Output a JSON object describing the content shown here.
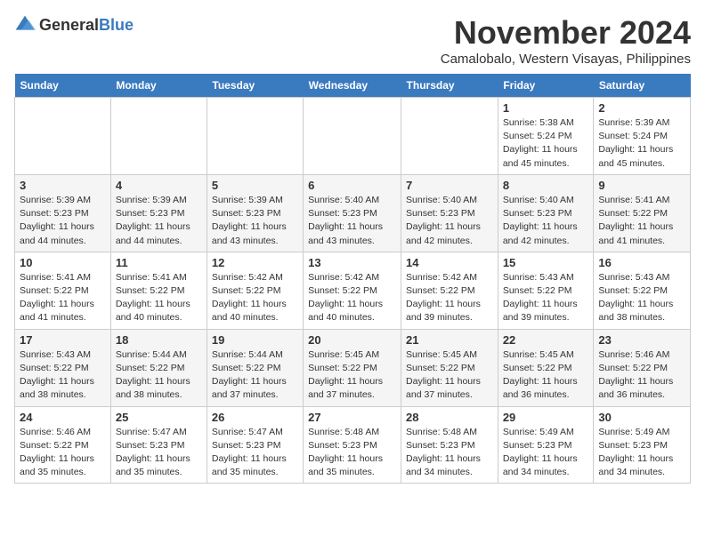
{
  "logo": {
    "general": "General",
    "blue": "Blue"
  },
  "header": {
    "month_year": "November 2024",
    "location": "Camalobalo, Western Visayas, Philippines"
  },
  "days_of_week": [
    "Sunday",
    "Monday",
    "Tuesday",
    "Wednesday",
    "Thursday",
    "Friday",
    "Saturday"
  ],
  "weeks": [
    [
      {
        "day": "",
        "info": ""
      },
      {
        "day": "",
        "info": ""
      },
      {
        "day": "",
        "info": ""
      },
      {
        "day": "",
        "info": ""
      },
      {
        "day": "",
        "info": ""
      },
      {
        "day": "1",
        "info": "Sunrise: 5:38 AM\nSunset: 5:24 PM\nDaylight: 11 hours and 45 minutes."
      },
      {
        "day": "2",
        "info": "Sunrise: 5:39 AM\nSunset: 5:24 PM\nDaylight: 11 hours and 45 minutes."
      }
    ],
    [
      {
        "day": "3",
        "info": "Sunrise: 5:39 AM\nSunset: 5:23 PM\nDaylight: 11 hours and 44 minutes."
      },
      {
        "day": "4",
        "info": "Sunrise: 5:39 AM\nSunset: 5:23 PM\nDaylight: 11 hours and 44 minutes."
      },
      {
        "day": "5",
        "info": "Sunrise: 5:39 AM\nSunset: 5:23 PM\nDaylight: 11 hours and 43 minutes."
      },
      {
        "day": "6",
        "info": "Sunrise: 5:40 AM\nSunset: 5:23 PM\nDaylight: 11 hours and 43 minutes."
      },
      {
        "day": "7",
        "info": "Sunrise: 5:40 AM\nSunset: 5:23 PM\nDaylight: 11 hours and 42 minutes."
      },
      {
        "day": "8",
        "info": "Sunrise: 5:40 AM\nSunset: 5:23 PM\nDaylight: 11 hours and 42 minutes."
      },
      {
        "day": "9",
        "info": "Sunrise: 5:41 AM\nSunset: 5:22 PM\nDaylight: 11 hours and 41 minutes."
      }
    ],
    [
      {
        "day": "10",
        "info": "Sunrise: 5:41 AM\nSunset: 5:22 PM\nDaylight: 11 hours and 41 minutes."
      },
      {
        "day": "11",
        "info": "Sunrise: 5:41 AM\nSunset: 5:22 PM\nDaylight: 11 hours and 40 minutes."
      },
      {
        "day": "12",
        "info": "Sunrise: 5:42 AM\nSunset: 5:22 PM\nDaylight: 11 hours and 40 minutes."
      },
      {
        "day": "13",
        "info": "Sunrise: 5:42 AM\nSunset: 5:22 PM\nDaylight: 11 hours and 40 minutes."
      },
      {
        "day": "14",
        "info": "Sunrise: 5:42 AM\nSunset: 5:22 PM\nDaylight: 11 hours and 39 minutes."
      },
      {
        "day": "15",
        "info": "Sunrise: 5:43 AM\nSunset: 5:22 PM\nDaylight: 11 hours and 39 minutes."
      },
      {
        "day": "16",
        "info": "Sunrise: 5:43 AM\nSunset: 5:22 PM\nDaylight: 11 hours and 38 minutes."
      }
    ],
    [
      {
        "day": "17",
        "info": "Sunrise: 5:43 AM\nSunset: 5:22 PM\nDaylight: 11 hours and 38 minutes."
      },
      {
        "day": "18",
        "info": "Sunrise: 5:44 AM\nSunset: 5:22 PM\nDaylight: 11 hours and 38 minutes."
      },
      {
        "day": "19",
        "info": "Sunrise: 5:44 AM\nSunset: 5:22 PM\nDaylight: 11 hours and 37 minutes."
      },
      {
        "day": "20",
        "info": "Sunrise: 5:45 AM\nSunset: 5:22 PM\nDaylight: 11 hours and 37 minutes."
      },
      {
        "day": "21",
        "info": "Sunrise: 5:45 AM\nSunset: 5:22 PM\nDaylight: 11 hours and 37 minutes."
      },
      {
        "day": "22",
        "info": "Sunrise: 5:45 AM\nSunset: 5:22 PM\nDaylight: 11 hours and 36 minutes."
      },
      {
        "day": "23",
        "info": "Sunrise: 5:46 AM\nSunset: 5:22 PM\nDaylight: 11 hours and 36 minutes."
      }
    ],
    [
      {
        "day": "24",
        "info": "Sunrise: 5:46 AM\nSunset: 5:22 PM\nDaylight: 11 hours and 35 minutes."
      },
      {
        "day": "25",
        "info": "Sunrise: 5:47 AM\nSunset: 5:23 PM\nDaylight: 11 hours and 35 minutes."
      },
      {
        "day": "26",
        "info": "Sunrise: 5:47 AM\nSunset: 5:23 PM\nDaylight: 11 hours and 35 minutes."
      },
      {
        "day": "27",
        "info": "Sunrise: 5:48 AM\nSunset: 5:23 PM\nDaylight: 11 hours and 35 minutes."
      },
      {
        "day": "28",
        "info": "Sunrise: 5:48 AM\nSunset: 5:23 PM\nDaylight: 11 hours and 34 minutes."
      },
      {
        "day": "29",
        "info": "Sunrise: 5:49 AM\nSunset: 5:23 PM\nDaylight: 11 hours and 34 minutes."
      },
      {
        "day": "30",
        "info": "Sunrise: 5:49 AM\nSunset: 5:23 PM\nDaylight: 11 hours and 34 minutes."
      }
    ]
  ]
}
